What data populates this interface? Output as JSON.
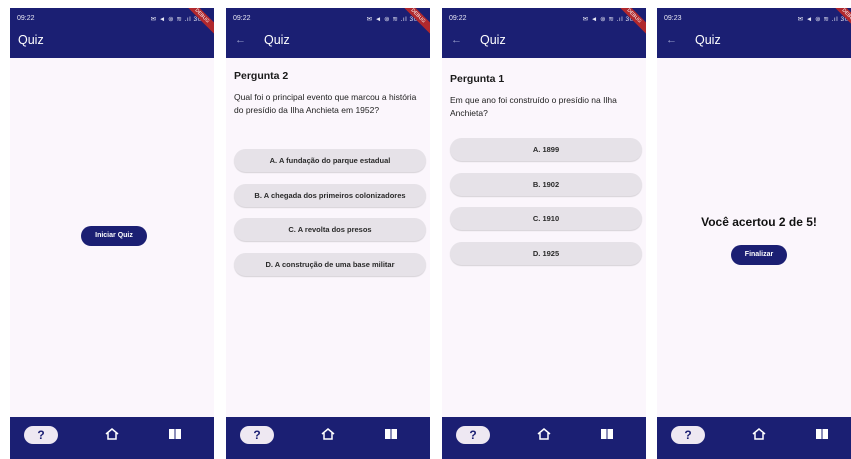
{
  "status": {
    "time_1": "09:22",
    "time_2": "09:22",
    "time_3": "09:22",
    "time_4": "09:23",
    "icons": "✉ ◄ ⊚ ≋ .ıl 30%",
    "debug": "DEBUG"
  },
  "app": {
    "title": "Quiz"
  },
  "screen1": {
    "start_button": "Iniciar Quiz"
  },
  "screen2": {
    "question_title": "Pergunta 2",
    "question_text": "Qual foi o principal evento que marcou a história do presídio da Ilha Anchieta em 1952?",
    "options": [
      "A. A fundação do parque estadual",
      "B. A chegada dos primeiros colonizadores",
      "C. A revolta dos presos",
      "D. A construção de uma base militar"
    ]
  },
  "screen3": {
    "question_title": "Pergunta 1",
    "question_text": "Em que ano foi construído o presídio na Ilha Anchieta?",
    "options": [
      "A. 1899",
      "B. 1902",
      "C. 1910",
      "D. 1925"
    ]
  },
  "screen4": {
    "result_text": "Você acertou 2 de 5!",
    "finish_button": "Finalizar"
  },
  "nav": {
    "quiz_label": "?",
    "home_icon": "home-icon",
    "book_icon": "book-icon"
  },
  "colors": {
    "primary": "#1b1f73",
    "background": "#fbf6fc",
    "option_bg": "#e6e2e8"
  }
}
